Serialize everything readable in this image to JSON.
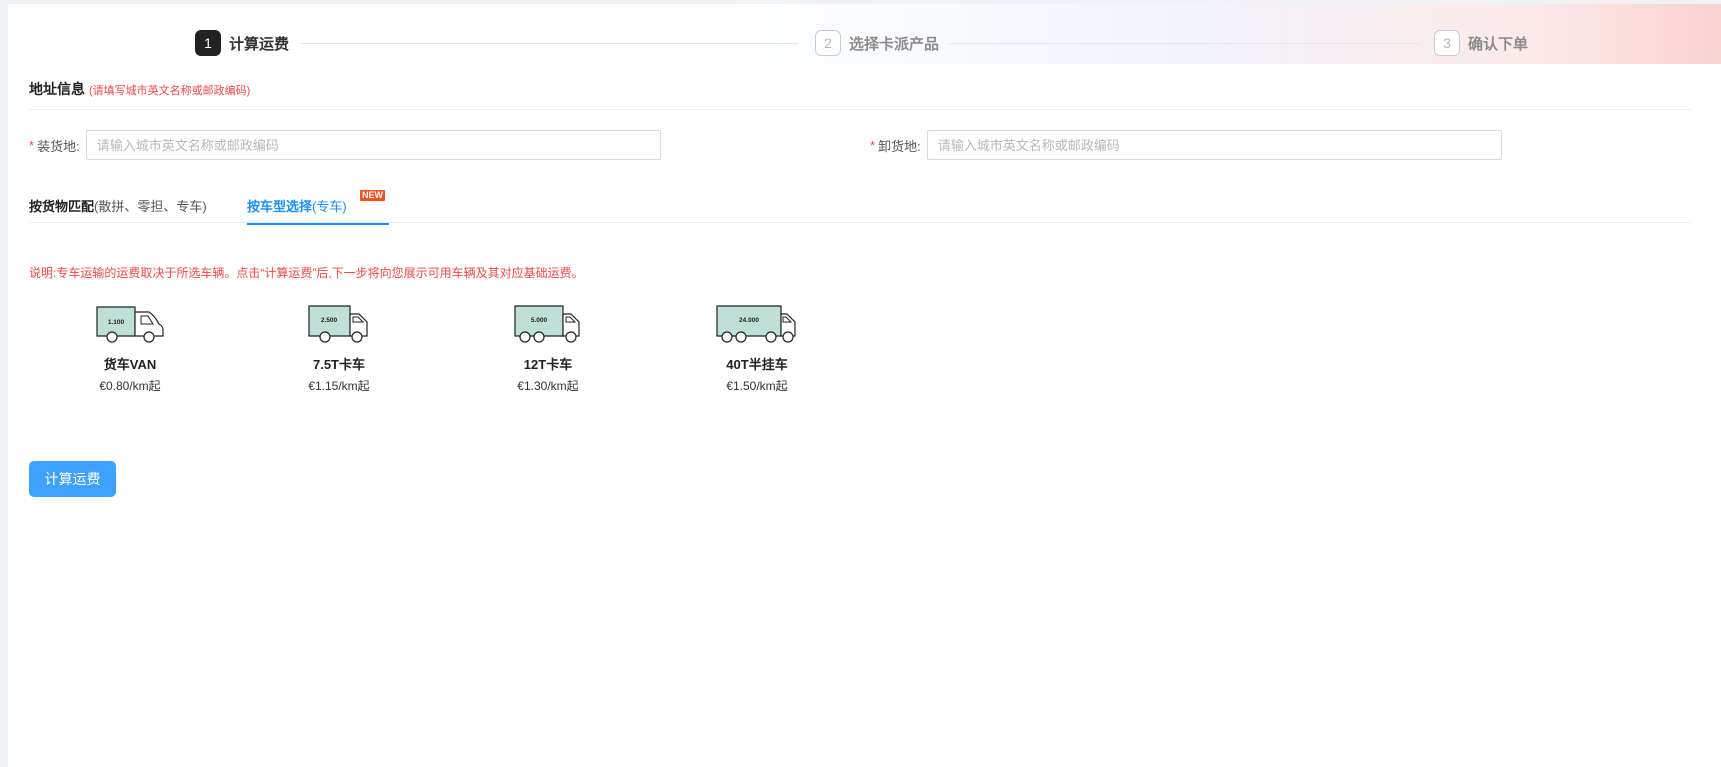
{
  "steps": [
    {
      "num": "1",
      "label": "计算运费",
      "active": true
    },
    {
      "num": "2",
      "label": "选择卡派产品",
      "active": false
    },
    {
      "num": "3",
      "label": "确认下单",
      "active": false
    }
  ],
  "address": {
    "title": "地址信息",
    "hint": "(请填写城市英文名称或邮政编码)",
    "required_mark": "*",
    "loading": {
      "label": "装货地:",
      "value": "",
      "placeholder": "请输入城市英文名称或邮政编码"
    },
    "unloading": {
      "label": "卸货地:",
      "value": "",
      "placeholder": "请输入城市英文名称或邮政编码"
    }
  },
  "tabs": {
    "cargo": {
      "main": "按货物匹配",
      "sub": "(散拼、零担、专车)"
    },
    "vehicle": {
      "main": "按车型选择",
      "sub": "(专车)",
      "badge": "NEW"
    }
  },
  "note": "说明:专车运输的运费取决于所选车辆。点击“计算运费”后,下一步将向您展示可用车辆及其对应基础运费。",
  "vehicles": [
    {
      "name": "货车VAN",
      "price": "€0.80/km起",
      "capacity": "1.100",
      "icon": "van-icon"
    },
    {
      "name": "7.5T卡车",
      "price": "€1.15/km起",
      "capacity": "2.500",
      "icon": "truck-icon"
    },
    {
      "name": "12T卡车",
      "price": "€1.30/km起",
      "capacity": "5.000",
      "icon": "truck-icon"
    },
    {
      "name": "40T半挂车",
      "price": "€1.50/km起",
      "capacity": "24.000",
      "icon": "semi-trailer-icon"
    }
  ],
  "calc_button": "计算运费",
  "colors": {
    "accent": "#1890ff",
    "button": "#3ea0ff",
    "required": "#f04848",
    "cargo_fill": "#bfe0d6"
  }
}
